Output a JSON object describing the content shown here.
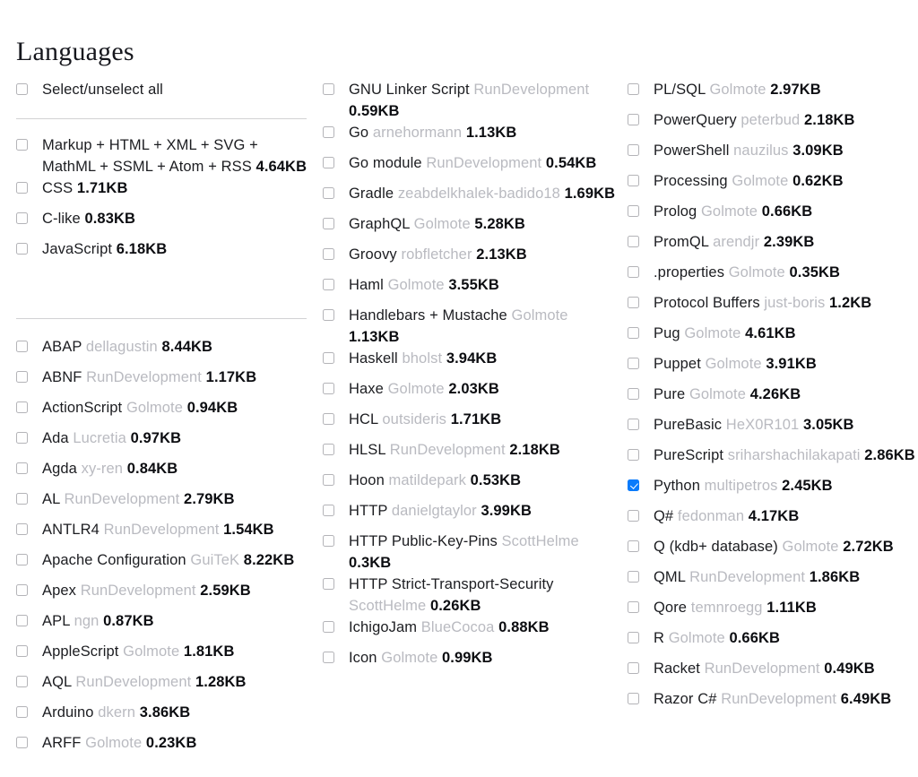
{
  "page": {
    "title": "Languages",
    "accent_color": "#0a7bfb",
    "label_color": "#1c1d21",
    "author_color": "#b9bac0",
    "size_color": "#0c0d11",
    "divider_color": "#d2d2d4",
    "background": "#ffffff"
  },
  "select_all": {
    "label": "Select/unselect all",
    "checked": false
  },
  "columns": [
    {
      "name": "column-1",
      "groups": [
        {
          "name": "core-languages",
          "items": [
            {
              "label": "Markup + HTML + XML + SVG + MathML + SSML + Atom + RSS",
              "author": "",
              "size": "4.64KB",
              "checked": false
            },
            {
              "label": "CSS",
              "author": "",
              "size": "1.71KB",
              "checked": false
            },
            {
              "label": "C-like",
              "author": "",
              "size": "0.83KB",
              "checked": false
            },
            {
              "label": "JavaScript",
              "author": "",
              "size": "6.18KB",
              "checked": false
            }
          ]
        },
        {
          "name": "extra-languages-a",
          "items": [
            {
              "label": "ABAP",
              "author": "dellagustin",
              "size": "8.44KB",
              "checked": false
            },
            {
              "label": "ABNF",
              "author": "RunDevelopment",
              "size": "1.17KB",
              "checked": false
            },
            {
              "label": "ActionScript",
              "author": "Golmote",
              "size": "0.94KB",
              "checked": false
            },
            {
              "label": "Ada",
              "author": "Lucretia",
              "size": "0.97KB",
              "checked": false
            },
            {
              "label": "Agda",
              "author": "xy-ren",
              "size": "0.84KB",
              "checked": false
            },
            {
              "label": "AL",
              "author": "RunDevelopment",
              "size": "2.79KB",
              "checked": false
            },
            {
              "label": "ANTLR4",
              "author": "RunDevelopment",
              "size": "1.54KB",
              "checked": false
            },
            {
              "label": "Apache Configuration",
              "author": "GuiTeK",
              "size": "8.22KB",
              "checked": false
            },
            {
              "label": "Apex",
              "author": "RunDevelopment",
              "size": "2.59KB",
              "checked": false
            },
            {
              "label": "APL",
              "author": "ngn",
              "size": "0.87KB",
              "checked": false
            },
            {
              "label": "AppleScript",
              "author": "Golmote",
              "size": "1.81KB",
              "checked": false
            },
            {
              "label": "AQL",
              "author": "RunDevelopment",
              "size": "1.28KB",
              "checked": false
            },
            {
              "label": "Arduino",
              "author": "dkern",
              "size": "3.86KB",
              "checked": false
            },
            {
              "label": "ARFF",
              "author": "Golmote",
              "size": "0.23KB",
              "checked": false
            }
          ]
        }
      ]
    },
    {
      "name": "column-2",
      "groups": [
        {
          "name": "languages-g-to-i",
          "items": [
            {
              "label": "GNU Linker Script",
              "author": "RunDevelopment",
              "size": "0.59KB",
              "checked": false
            },
            {
              "label": "Go",
              "author": "arnehormann",
              "size": "1.13KB",
              "checked": false
            },
            {
              "label": "Go module",
              "author": "RunDevelopment",
              "size": "0.54KB",
              "checked": false
            },
            {
              "label": "Gradle",
              "author": "zeabdelkhalek-badido18",
              "size": "1.69KB",
              "checked": false
            },
            {
              "label": "GraphQL",
              "author": "Golmote",
              "size": "5.28KB",
              "checked": false
            },
            {
              "label": "Groovy",
              "author": "robfletcher",
              "size": "2.13KB",
              "checked": false
            },
            {
              "label": "Haml",
              "author": "Golmote",
              "size": "3.55KB",
              "checked": false
            },
            {
              "label": "Handlebars + Mustache",
              "author": "Golmote",
              "size": "1.13KB",
              "checked": false
            },
            {
              "label": "Haskell",
              "author": "bholst",
              "size": "3.94KB",
              "checked": false
            },
            {
              "label": "Haxe",
              "author": "Golmote",
              "size": "2.03KB",
              "checked": false
            },
            {
              "label": "HCL",
              "author": "outsideris",
              "size": "1.71KB",
              "checked": false
            },
            {
              "label": "HLSL",
              "author": "RunDevelopment",
              "size": "2.18KB",
              "checked": false
            },
            {
              "label": "Hoon",
              "author": "matildepark",
              "size": "0.53KB",
              "checked": false
            },
            {
              "label": "HTTP",
              "author": "danielgtaylor",
              "size": "3.99KB",
              "checked": false
            },
            {
              "label": "HTTP Public-Key-Pins",
              "author": "ScottHelme",
              "size": "0.3KB",
              "checked": false
            },
            {
              "label": "HTTP Strict-Transport-Security",
              "author": "ScottHelme",
              "size": "0.26KB",
              "checked": false
            },
            {
              "label": "IchigoJam",
              "author": "BlueCocoa",
              "size": "0.88KB",
              "checked": false
            },
            {
              "label": "Icon",
              "author": "Golmote",
              "size": "0.99KB",
              "checked": false
            }
          ]
        }
      ]
    },
    {
      "name": "column-3",
      "groups": [
        {
          "name": "languages-p-to-r",
          "items": [
            {
              "label": "PL/SQL",
              "author": "Golmote",
              "size": "2.97KB",
              "checked": false
            },
            {
              "label": "PowerQuery",
              "author": "peterbud",
              "size": "2.18KB",
              "checked": false
            },
            {
              "label": "PowerShell",
              "author": "nauzilus",
              "size": "3.09KB",
              "checked": false
            },
            {
              "label": "Processing",
              "author": "Golmote",
              "size": "0.62KB",
              "checked": false
            },
            {
              "label": "Prolog",
              "author": "Golmote",
              "size": "0.66KB",
              "checked": false
            },
            {
              "label": "PromQL",
              "author": "arendjr",
              "size": "2.39KB",
              "checked": false
            },
            {
              "label": ".properties",
              "author": "Golmote",
              "size": "0.35KB",
              "checked": false
            },
            {
              "label": "Protocol Buffers",
              "author": "just-boris",
              "size": "1.2KB",
              "checked": false
            },
            {
              "label": "Pug",
              "author": "Golmote",
              "size": "4.61KB",
              "checked": false
            },
            {
              "label": "Puppet",
              "author": "Golmote",
              "size": "3.91KB",
              "checked": false
            },
            {
              "label": "Pure",
              "author": "Golmote",
              "size": "4.26KB",
              "checked": false
            },
            {
              "label": "PureBasic",
              "author": "HeX0R101",
              "size": "3.05KB",
              "checked": false
            },
            {
              "label": "PureScript",
              "author": "sriharshachilakapati",
              "size": "2.86KB",
              "checked": false
            },
            {
              "label": "Python",
              "author": "multipetros",
              "size": "2.45KB",
              "checked": true
            },
            {
              "label": "Q#",
              "author": "fedonman",
              "size": "4.17KB",
              "checked": false
            },
            {
              "label": "Q (kdb+ database)",
              "author": "Golmote",
              "size": "2.72KB",
              "checked": false
            },
            {
              "label": "QML",
              "author": "RunDevelopment",
              "size": "1.86KB",
              "checked": false
            },
            {
              "label": "Qore",
              "author": "temnroegg",
              "size": "1.11KB",
              "checked": false
            },
            {
              "label": "R",
              "author": "Golmote",
              "size": "0.66KB",
              "checked": false
            },
            {
              "label": "Racket",
              "author": "RunDevelopment",
              "size": "0.49KB",
              "checked": false
            },
            {
              "label": "Razor C#",
              "author": "RunDevelopment",
              "size": "6.49KB",
              "checked": false
            }
          ]
        }
      ]
    }
  ]
}
